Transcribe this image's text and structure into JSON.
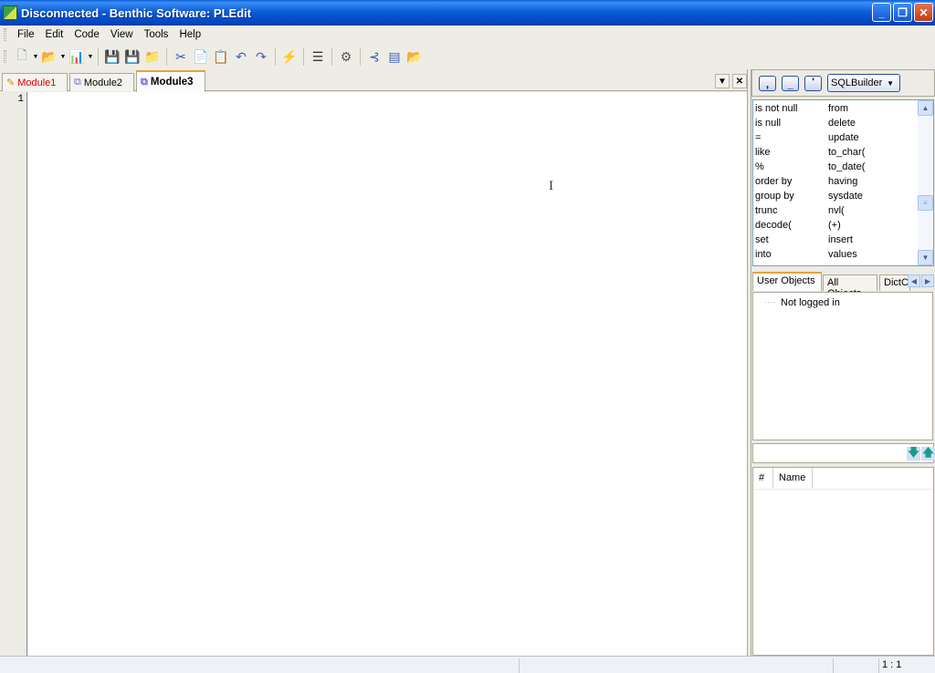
{
  "window": {
    "title": "Disconnected - Benthic Software: PLEdit",
    "buttons": {
      "minimize": "_",
      "restore": "❐",
      "close": "✕"
    }
  },
  "menu": [
    {
      "label": "File",
      "accel": "F"
    },
    {
      "label": "Edit",
      "accel": "E"
    },
    {
      "label": "Code",
      "accel": "C"
    },
    {
      "label": "View",
      "accel": "V"
    },
    {
      "label": "Tools",
      "accel": "T"
    },
    {
      "label": "Help",
      "accel": "H"
    }
  ],
  "toolbar": {
    "icons": [
      "new-file-icon",
      "open-folder-icon",
      "chart-icon",
      "save-icon",
      "save-all-icon",
      "open-project-icon",
      "cut-icon",
      "copy-icon",
      "paste-icon",
      "undo-icon",
      "redo-icon",
      "execute-icon",
      "document-icon",
      "gears-icon",
      "tree-icon",
      "form-icon",
      "folder-edit-icon"
    ],
    "glyphs": {
      "new": "🗋",
      "open": "📂",
      "chart": "📊",
      "save": "💾",
      "save_all": "💾",
      "open_project": "📁",
      "cut": "✂",
      "copy": "📄",
      "paste": "📋",
      "undo": "↶",
      "redo": "↷",
      "execute": "⚡",
      "document": "☰",
      "gears": "⚙",
      "tree": "⊰",
      "form": "▤",
      "folder_edit": "📂"
    }
  },
  "tabs": [
    {
      "label": "Module1",
      "modified": true,
      "color": "#e00000"
    },
    {
      "label": "Module2",
      "modified": false
    },
    {
      "label": "Module3",
      "active": true
    }
  ],
  "tab_controls": {
    "dropdown": "▼",
    "close": "✕"
  },
  "editor": {
    "line_numbers": [
      "1"
    ],
    "content": ""
  },
  "sql_builder": {
    "buttons": [
      ",",
      "_",
      "'"
    ],
    "mode": "SQLBuilder",
    "keywords": [
      [
        "is not null",
        "from"
      ],
      [
        "is null",
        "delete"
      ],
      [
        "=",
        "update"
      ],
      [
        "like",
        "to_char("
      ],
      [
        "%",
        "to_date("
      ],
      [
        "order by",
        "having"
      ],
      [
        "group by",
        "sysdate"
      ],
      [
        "trunc",
        "nvl("
      ],
      [
        "decode(",
        "(+)"
      ],
      [
        "set",
        "insert"
      ],
      [
        "into",
        "values"
      ]
    ]
  },
  "object_tabs": [
    "User Objects",
    "All Objects",
    "DictC"
  ],
  "object_tree": {
    "status": "Not logged in"
  },
  "columns": {
    "headers": [
      "#",
      "Name"
    ]
  },
  "statusbar": {
    "position": "1 : 1"
  }
}
